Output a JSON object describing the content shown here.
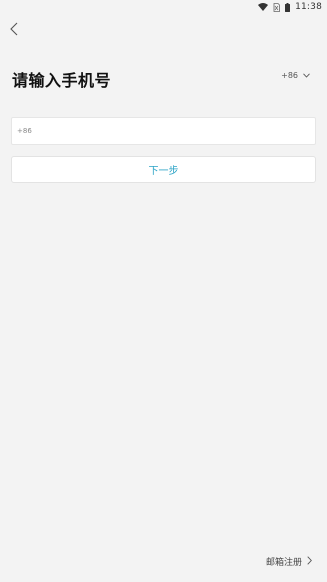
{
  "status_bar": {
    "time": "11:38",
    "icons": [
      "wifi-icon",
      "sim-none-icon",
      "battery-icon"
    ]
  },
  "header": {
    "back_icon": "chevron-left-icon"
  },
  "main": {
    "title": "请输入手机号",
    "country_code": "+86",
    "country_code_icon": "chevron-down-icon",
    "phone_prefix": "+86",
    "phone_value": "",
    "next_label": "下一步"
  },
  "footer": {
    "email_register_label": "邮箱注册",
    "email_register_icon": "chevron-right-icon"
  },
  "colors": {
    "background": "#f3f3f3",
    "accent": "#2aa3c6"
  }
}
